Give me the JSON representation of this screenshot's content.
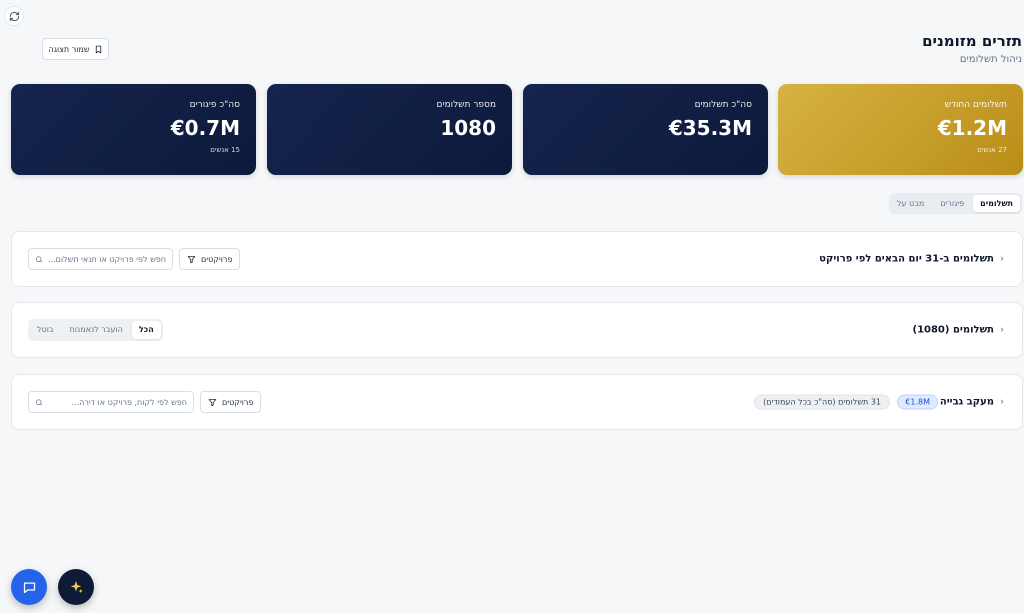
{
  "header": {
    "title": "תזרים מזומנים",
    "subtitle": "ניהול תשלומים",
    "save_view_label": "שמור תצוגה"
  },
  "cards": [
    {
      "label": "תשלומים החודש",
      "value": "€1.2M",
      "sub": "27 אנשים",
      "style": "gold"
    },
    {
      "label": "סה\"כ תשלומים",
      "value": "€35.3M",
      "sub": "",
      "style": "navy"
    },
    {
      "label": "מספר תשלומים",
      "value": "1080",
      "sub": "",
      "style": "navy"
    },
    {
      "label": "סה\"כ פיגורים",
      "value": "€0.7M",
      "sub": "15 אנשים",
      "style": "navy"
    }
  ],
  "tabs": {
    "items": [
      "תשלומים",
      "פיגורים",
      "מבט על"
    ],
    "active": "תשלומים"
  },
  "sections": {
    "upcoming": {
      "title": "תשלומים ב-31 יום הבאים לפי פרויקט",
      "filter_label": "פרויקטים",
      "search_placeholder": "חפש לפי פרויקט או תנאי תשלום..."
    },
    "payments": {
      "title": "תשלומים (1080)",
      "segments": [
        "הכל",
        "הועבר לנאמנות",
        "בוטל"
      ],
      "active_segment": "הכל"
    },
    "collection": {
      "title": "מעקב גבייה",
      "amount_badge": "€1.8M",
      "count_badge": "31 תשלומים (סה\"כ בכל העמודים)",
      "filter_label": "פרויקטים",
      "search_placeholder": "חפש לפי לקוח, פרויקט או דירה..."
    }
  },
  "colors": {
    "navy": "#11204a",
    "gold": "#c9a130",
    "chat_button": "#2563eb",
    "ai_button": "#0f1a36"
  },
  "icons": {
    "refresh": "refresh-icon",
    "bookmark": "bookmark-icon",
    "chevron": "chevron-left-icon",
    "filter": "filter-icon",
    "search": "search-icon",
    "chat": "chat-icon",
    "sparkles": "sparkles-icon"
  }
}
